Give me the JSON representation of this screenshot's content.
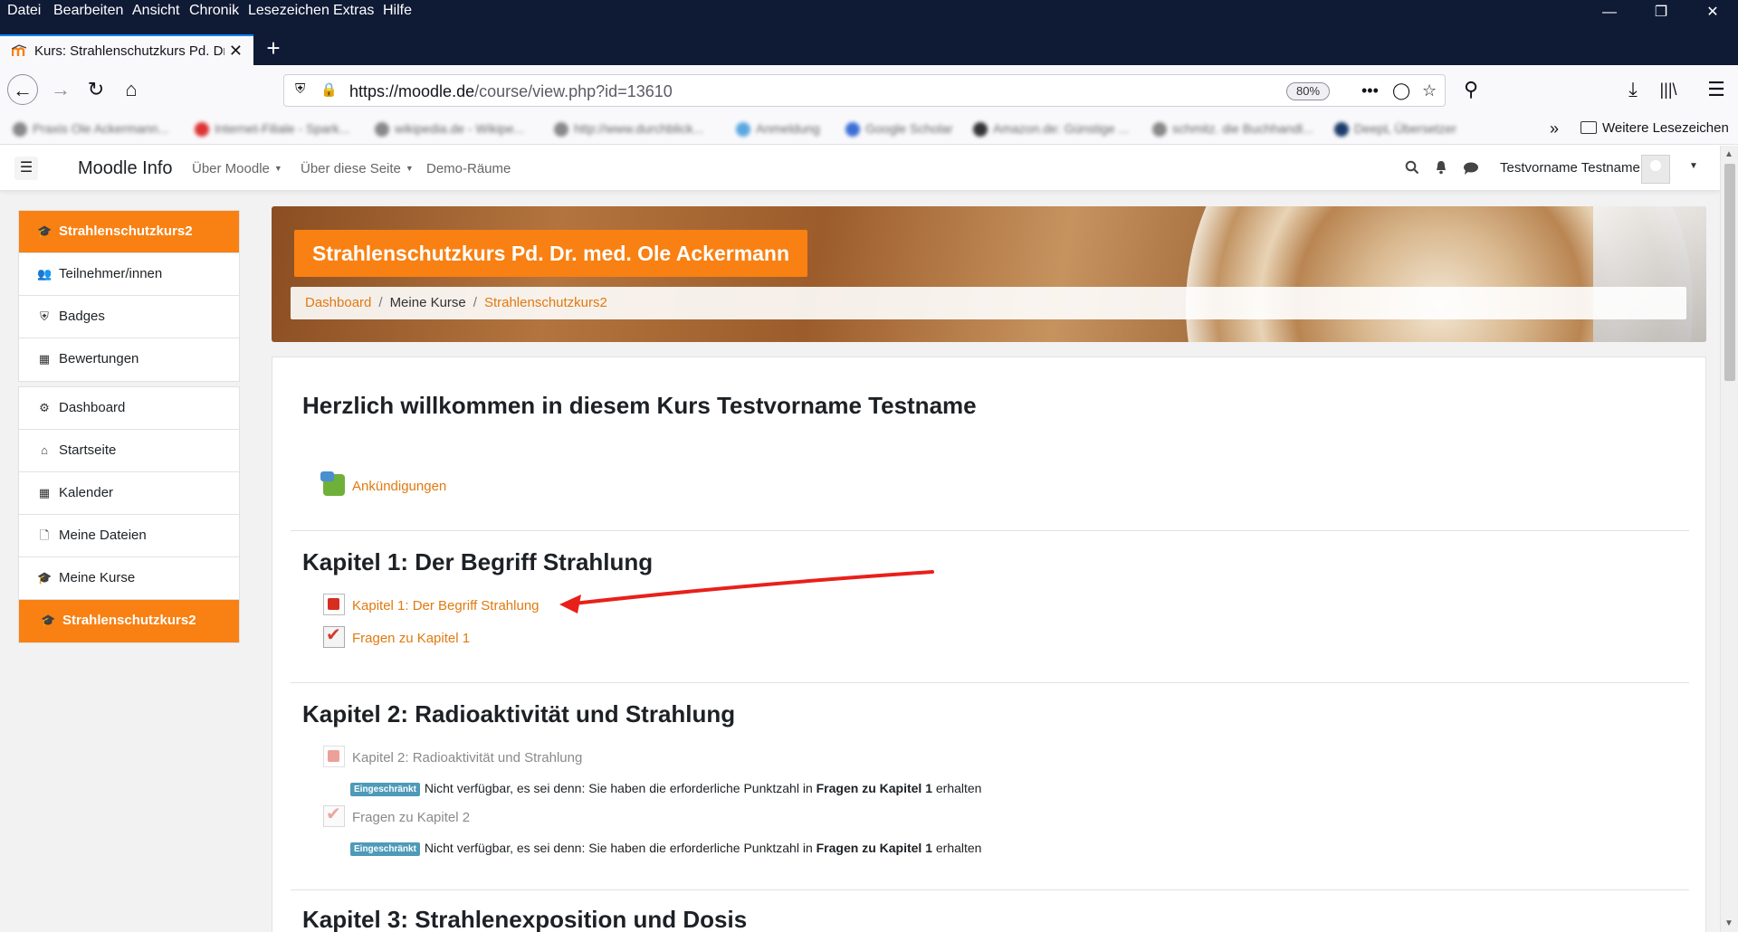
{
  "browser": {
    "menu": [
      "Datei",
      "Bearbeiten",
      "Ansicht",
      "Chronik",
      "Lesezeichen",
      "Extras",
      "Hilfe"
    ],
    "tab_title": "Kurs: Strahlenschutzkurs Pd. Dr. med. Ole Ackermann",
    "url_host": "https://moodle.de",
    "url_path": "/course/view.php?id=13610",
    "zoom": "80%",
    "bookmarks": [
      "Praxis Ole Ackermann...",
      "Internet-Filiale - Spark...",
      "wikipedia.de - Wikipe...",
      "http://www.durchblick...",
      "Anmeldung",
      "Google Scholar",
      "Amazon.de: Günstige ...",
      "schmitz. die Buchhandl...",
      "DeepL Übersetzer"
    ],
    "bookmarks_folder": "Weitere Lesezeichen"
  },
  "navbar": {
    "site_name": "Moodle Info",
    "menus": [
      "Über Moodle",
      "Über diese Seite",
      "Demo-Räume"
    ],
    "user_name": "Testvorname Testname"
  },
  "sidebar": {
    "course_group": [
      "Strahlenschutzkurs2",
      "Teilnehmer/innen",
      "Badges",
      "Bewertungen"
    ],
    "site_group": [
      "Dashboard",
      "Startseite",
      "Kalender",
      "Meine Dateien",
      "Meine Kurse",
      "Strahlenschutzkurs2"
    ]
  },
  "header": {
    "course_title": "Strahlenschutzkurs Pd. Dr. med. Ole Ackermann",
    "breadcrumb": [
      "Dashboard",
      "Meine Kurse",
      "Strahlenschutzkurs2"
    ]
  },
  "main": {
    "welcome": "Herzlich willkommen in diesem Kurs Testvorname Testname",
    "announcements": "Ankündigungen",
    "sections": [
      {
        "title": "Kapitel 1: Der Begriff Strahlung",
        "activities": [
          "Kapitel 1: Der Begriff Strahlung",
          "Fragen zu Kapitel 1"
        ]
      },
      {
        "title": "Kapitel 2: Radioaktivität und Strahlung",
        "activities": [
          "Kapitel 2: Radioaktivität und Strahlung",
          "Fragen zu Kapitel 2"
        ],
        "restriction_badge": "Eingeschränkt",
        "restriction_text_pre": "Nicht verfügbar, es sei denn: Sie haben die erforderliche Punktzahl in",
        "restriction_bold": "Fragen zu Kapitel 1",
        "restriction_text_post": "erhalten"
      },
      {
        "title": "Kapitel 3: Strahlenexposition und Dosis"
      }
    ]
  },
  "annotation": {
    "arrow_color": "#e8201a"
  }
}
